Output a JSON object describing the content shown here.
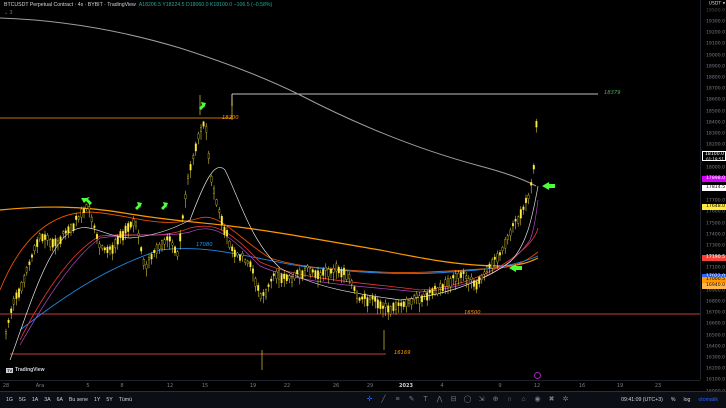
{
  "legend": {
    "title": "BTCUSDT Perpetual Contract · 4s · BYBIT · TradingView",
    "ohlc": "A18206.5 Y18224.5 D18060.0 K18100.0 −106.5 (−0.58%)",
    "collapse": "⌄ 3"
  },
  "price_axis": {
    "currency": "USDT ▾",
    "top_partial": "19500.0",
    "labels": [
      "19300.0",
      "19200.0",
      "19100.0",
      "19000.0",
      "18900.0",
      "18800.0",
      "18700.0",
      "18600.0",
      "18500.0",
      "18400.0",
      "18300.0",
      "18200.0",
      "18000.0",
      "17900.0",
      "17800.0",
      "17700.0",
      "17600.0",
      "17500.0",
      "17400.0",
      "17300.0",
      "17200.0",
      "17100.0",
      "17000.0",
      "16900.0",
      "16800.0",
      "16700.0",
      "16600.0",
      "16500.0",
      "16400.0",
      "16300.0",
      "16200.0",
      "16100.0",
      "16000.0",
      "15900.0"
    ],
    "badges": [
      {
        "text": "18100.0",
        "sub": "01:18:51",
        "color": "#ffffff",
        "bg": "#ffffff"
      },
      {
        "text": "17898.0",
        "color": "#ffffff",
        "bg": "#d500f9"
      },
      {
        "text": "17814.5",
        "color": "#000000",
        "bg": "#ffffff"
      },
      {
        "text": "17648.0",
        "color": "#000000",
        "bg": "#ffeb3b"
      },
      {
        "text": "17190.5",
        "color": "#ffffff",
        "bg": "#f44336"
      },
      {
        "text": "17022.0",
        "color": "#ffffff",
        "bg": "#2962ff"
      },
      {
        "text": "17000.5",
        "color": "#000000",
        "bg": "#ff9800"
      },
      {
        "text": "16940.0",
        "color": "#000000",
        "bg": "#ffb74d"
      }
    ]
  },
  "time_axis": [
    "28",
    "Ara",
    "5",
    "8",
    "12",
    "15",
    "19",
    "22",
    "26",
    "29",
    "2023",
    "4",
    "9",
    "12",
    "16",
    "19",
    "23"
  ],
  "annotations": [
    {
      "text": "18379",
      "color": "#4caf50"
    },
    {
      "text": "18200",
      "color": "#ff9800"
    },
    {
      "text": "17080",
      "color": "#2196f3"
    },
    {
      "text": "16500",
      "color": "#ff9800"
    },
    {
      "text": "16169",
      "color": "#ff9800"
    }
  ],
  "toolbar": {
    "ranges": [
      "1G",
      "5G",
      "1A",
      "3A",
      "6A",
      "Bu sene",
      "1Y",
      "5Y",
      "Tümü"
    ],
    "time": "09:41:09 (UTC+3)",
    "pct": "%",
    "log": "log",
    "auto": "otomatik"
  },
  "logo": "TradingView",
  "colors": {
    "candle": "#ffeb3b",
    "ma200": "#9e9e9e",
    "ema": "#ff9800"
  }
}
